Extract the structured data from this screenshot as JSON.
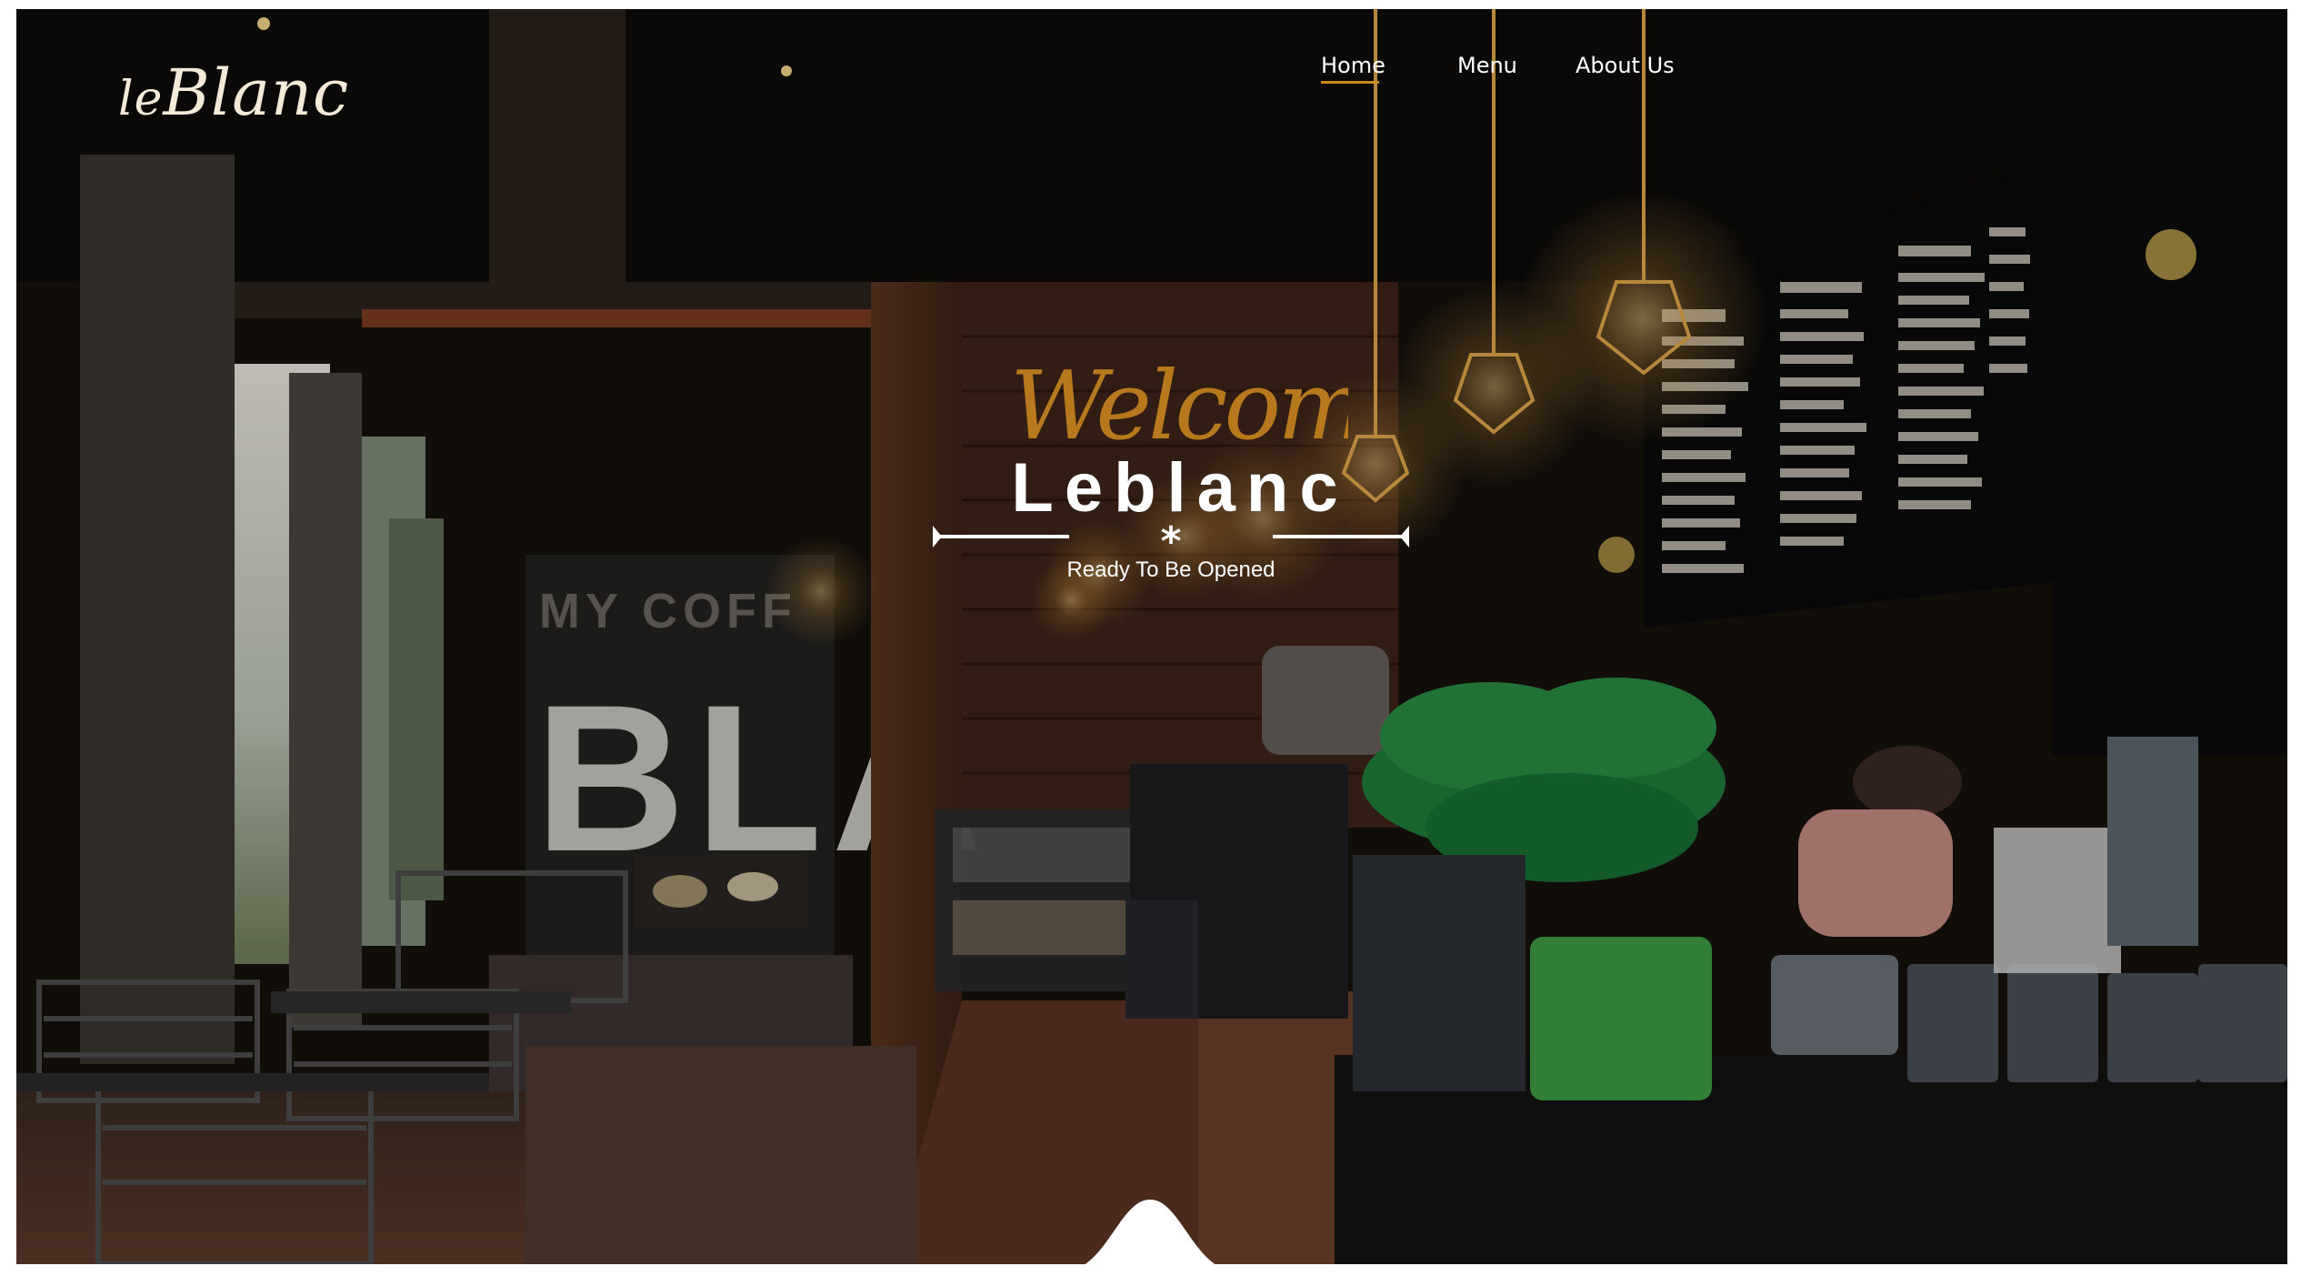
{
  "brand": {
    "logo_text": "leBlanc",
    "logo_prefix": "le",
    "logo_main": "Blanc"
  },
  "nav": {
    "items": [
      {
        "label": "Home",
        "active": true
      },
      {
        "label": "Menu",
        "active": false
      },
      {
        "label": "About Us",
        "active": false
      }
    ]
  },
  "hero": {
    "welcome_script": "Welcome",
    "title": "Leblanc",
    "divider_glyph": "*",
    "tagline": "Ready To Be Opened"
  },
  "colors": {
    "accent": "#c98a1b",
    "text": "#ffffff",
    "logo": "#f3ead8",
    "background": "#141009"
  },
  "icons": {
    "divider": "star-divider-icon",
    "scroll": "wave-scroll-icon"
  }
}
